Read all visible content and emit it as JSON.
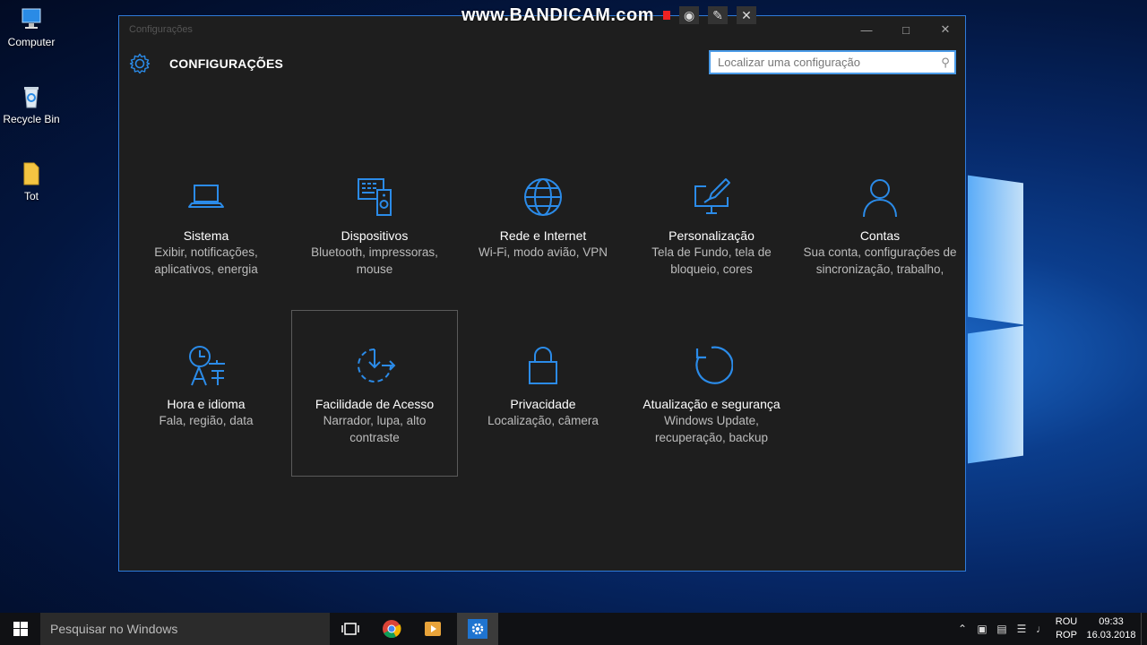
{
  "desktop": {
    "icons": [
      {
        "label": "Computer"
      },
      {
        "label": "Recycle Bin"
      },
      {
        "label": "Tot"
      }
    ]
  },
  "overlay": {
    "brand": "www.BANDICAM.com"
  },
  "window": {
    "title": "Configurações",
    "header_title": "CONFIGURAÇÕES",
    "search_placeholder": "Localizar uma configuração",
    "accent": "#2b8be8"
  },
  "tiles": [
    {
      "name": "Sistema",
      "desc": "Exibir, notificações, aplicativos, energia",
      "icon": "laptop-icon"
    },
    {
      "name": "Dispositivos",
      "desc": "Bluetooth, impressoras, mouse",
      "icon": "devices-icon"
    },
    {
      "name": "Rede e Internet",
      "desc": "Wi-Fi, modo avião, VPN",
      "icon": "globe-icon"
    },
    {
      "name": "Personalização",
      "desc": "Tela de Fundo, tela de bloqueio, cores",
      "icon": "paint-icon"
    },
    {
      "name": "Contas",
      "desc": "Sua conta, configurações de sincronização, trabalho,",
      "icon": "person-icon"
    },
    {
      "name": "Hora e idioma",
      "desc": "Fala, região, data",
      "icon": "clock-language-icon"
    },
    {
      "name": "Facilidade de Acesso",
      "desc": "Narrador, lupa, alto contraste",
      "icon": "ease-of-access-icon"
    },
    {
      "name": "Privacidade",
      "desc": "Localização, câmera",
      "icon": "lock-icon"
    },
    {
      "name": "Atualização e segurança",
      "desc": "Windows Update, recuperação, backup",
      "icon": "refresh-icon"
    }
  ],
  "taskbar": {
    "search_placeholder": "Pesquisar no Windows",
    "lang_top": "ROU",
    "lang_bottom": "ROP",
    "time": "09:33",
    "date": "16.03.2018"
  }
}
